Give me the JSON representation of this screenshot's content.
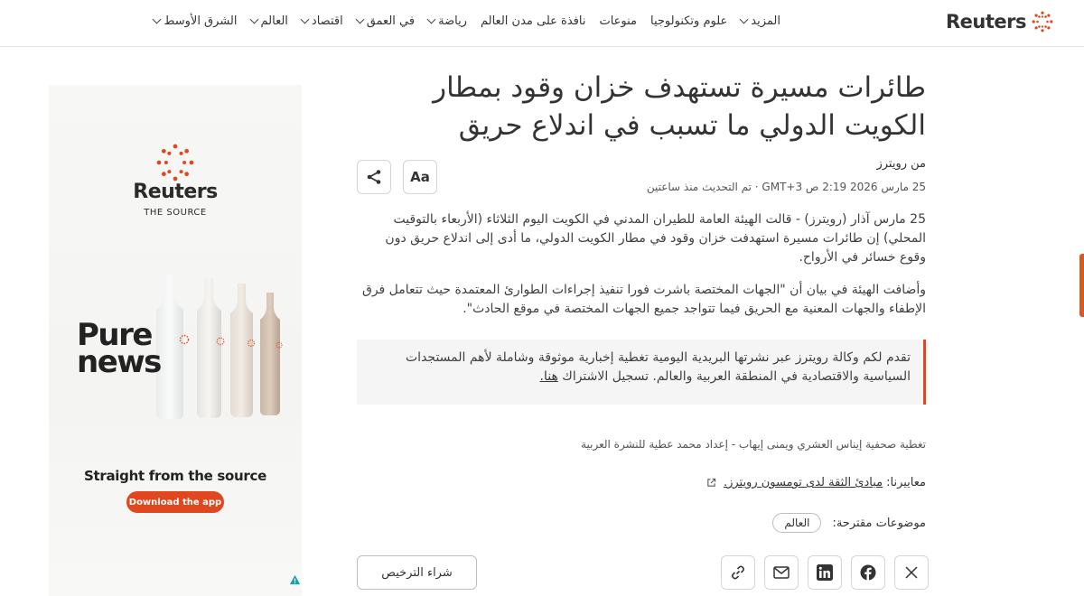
{
  "brand": {
    "name": "Reuters",
    "accent": "#e0471f"
  },
  "nav": {
    "items": [
      {
        "label": "الشرق الأوسط",
        "dropdown": true
      },
      {
        "label": "العالم",
        "dropdown": true
      },
      {
        "label": "اقتصاد",
        "dropdown": true
      },
      {
        "label": "في العمق",
        "dropdown": true
      },
      {
        "label": "رياضة",
        "dropdown": true
      },
      {
        "label": "نافذة على مدن العالم",
        "dropdown": false
      },
      {
        "label": "منوعات",
        "dropdown": false
      },
      {
        "label": "علوم وتكنولوجيا",
        "dropdown": false
      },
      {
        "label": "المزيد",
        "dropdown": true
      }
    ]
  },
  "ad": {
    "brand": "Reuters",
    "brand_sub": "THE SOURCE",
    "headline_line1": "Pure",
    "headline_line2": "news",
    "tagline": "Straight from the source",
    "cta": "Download the app"
  },
  "article": {
    "headline": "طائرات مسيرة تستهدف خزان وقود بمطار الكويت الدولي ما تسبب في اندلاع حريق",
    "byline": "من رويترز",
    "dateline": "25 مارس 2026 2:19 ص GMT+3 · تم التحديث منذ ساعتين",
    "text_size_label": "Aa",
    "paragraph1": "25 مارس آذار (رويترز) - قالت الهيئة العامة للطيران المدني في الكويت اليوم الثلاثاء (الأربعاء بالتوقيت المحلي) إن طائرات مسيرة استهدفت خزان وقود في مطار الكويت الدولي، ما أدى إلى اندلاع حريق دون وقوع خسائر في الأرواح.",
    "paragraph2": "وأضافت الهيئة في بيان أن \"الجهات المختصة باشرت فورا تنفيذ إجراءات الطوارئ المعتمدة حيث تتعامل فرق الإطفاء والجهات المعنية مع الحريق فيما تتواجد جميع الجهات المختصة في موقع الحادث\".",
    "promo_text": "تقدم لكم وكالة رويترز عبر نشرتها البريدية اليومية تغطية إخبارية موثوقة وشاملة لأهم المستجدات السياسية والاقتصادية في المنطقة العربية والعالم. تسجيل الاشتراك",
    "promo_link": "هنا.",
    "credit": "تغطية صحفية إيناس العشري ويمنى إيهاب - إعداد محمد عطية للنشرة العربية",
    "standards_label": "معاييرنا:",
    "standards_link": "مبادئ الثقة لدى تومسون رويترز.",
    "topics_label": "موضوعات مقترحة:",
    "topics": [
      "العالم"
    ],
    "license_label": "شراء الترخيص"
  },
  "icons": [
    "share-icon",
    "x-icon",
    "facebook-icon",
    "linkedin-icon",
    "email-icon",
    "link-icon",
    "external-link-icon"
  ]
}
